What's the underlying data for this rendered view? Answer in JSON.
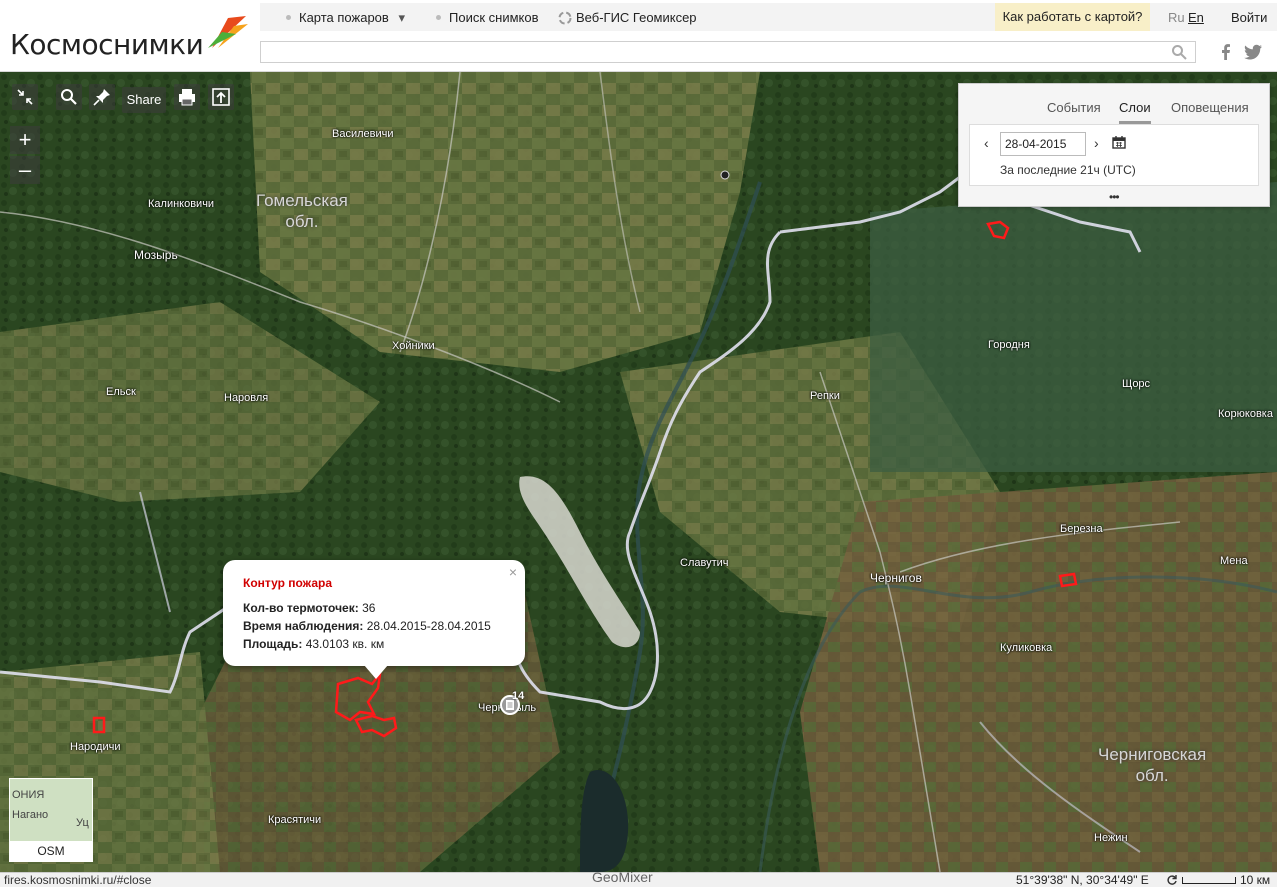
{
  "header": {
    "logo": "Космоснимки",
    "nav": [
      {
        "label": "Карта пожаров",
        "caret": "▾"
      },
      {
        "label": "Поиск снимков"
      },
      {
        "label": "Веб-ГИС Геомиксер"
      }
    ],
    "help": "Как работать с картой?",
    "lang_ru": "Ru",
    "lang_en": "En",
    "login": "Войти",
    "search_placeholder": ""
  },
  "map_tools": {
    "share": "Share",
    "zoom_in": "+",
    "zoom_out": "–"
  },
  "panel": {
    "tabs": [
      "События",
      "Слои",
      "Оповещения"
    ],
    "active_tab": "Слои",
    "date": "28-04-2015",
    "prev": "‹",
    "next": "›",
    "period": "За последние 21ч (UTC)",
    "more": "•••"
  },
  "places": {
    "vasilevichi": "Василевичи",
    "kalinkovichi": "Калинковичи",
    "mozyr": "Мозырь",
    "khoyniki": "Хойники",
    "elsk": "Ельск",
    "narovlya": "Наровля",
    "repki": "Репки",
    "gorodnya": "Городня",
    "shchors": "Щорс",
    "koryukovka": "Корюковка",
    "berezna": "Березна",
    "mena": "Мена",
    "slavutich": "Славутич",
    "chernigov": "Чернигов",
    "kulikovka": "Куликовка",
    "narodichi": "Народичи",
    "chernobyl": "Чернобыль",
    "krasyatichi": "Красятичи",
    "nezhin": "Нежин",
    "region_gomel": "Гомельская\nобл.",
    "region_chernigov": "Черниговская\nобл."
  },
  "popup": {
    "title": "Контур пожара",
    "close": "×",
    "thermo_label": "Кол-во термоточек:",
    "thermo_value": "36",
    "time_label": "Время наблюдения:",
    "time_value": "28.04.2015-28.04.2015",
    "area_label": "Площадь:",
    "area_value": "43.0103 кв. км"
  },
  "marker": {
    "count": "14"
  },
  "minimap": {
    "label": "OSM",
    "text1": "ОНИЯ",
    "text2": "Нагано",
    "text3": "Уц"
  },
  "status": {
    "url": "fires.kosmosnimki.ru/#close",
    "brand": "GeoMixer",
    "coords": "51°39'38\" N, 30°34'49\" E",
    "scale": "10 км"
  },
  "colors": {
    "fire": "#ff1a1a",
    "border": "#d8d8e8",
    "forest": "#2f4a22",
    "field": "#6e7a4a"
  }
}
